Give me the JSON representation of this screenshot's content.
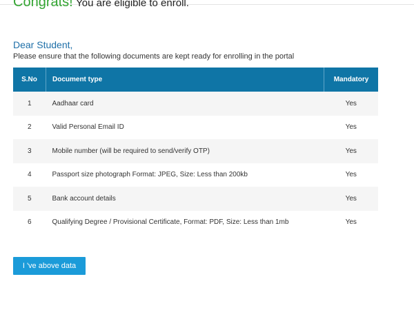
{
  "banner": {
    "congrats_word": "Congrats!",
    "congrats_rest": "You are eligible to enroll."
  },
  "greeting": "Dear Student,",
  "instruction": "Please ensure that the following documents are kept ready for enrolling in the portal",
  "table": {
    "headers": {
      "sno": "S.No",
      "doc": "Document type",
      "mandatory": "Mandatory"
    },
    "rows": [
      {
        "sno": "1",
        "doc": "Aadhaar card",
        "mandatory": "Yes"
      },
      {
        "sno": "2",
        "doc": "Valid Personal Email ID",
        "mandatory": "Yes"
      },
      {
        "sno": "3",
        "doc": "Mobile number (will be required to send/verify OTP)",
        "mandatory": "Yes"
      },
      {
        "sno": "4",
        "doc": "Passport size photograph Format: JPEG, Size: Less than 200kb",
        "mandatory": "Yes"
      },
      {
        "sno": "5",
        "doc": "Bank account details",
        "mandatory": "Yes"
      },
      {
        "sno": "6",
        "doc": "Qualifying Degree / Provisional Certificate, Format: PDF, Size: Less than 1mb",
        "mandatory": "Yes"
      }
    ]
  },
  "button": {
    "label": "I 've above data"
  },
  "colors": {
    "header_bg": "#0f75a6",
    "button_bg": "#1b9bd9",
    "congrats": "#33a532",
    "greeting": "#1e6fa8"
  }
}
